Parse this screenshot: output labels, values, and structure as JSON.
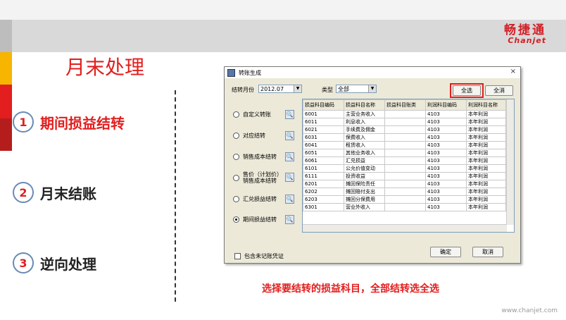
{
  "brand": {
    "name_cn": "畅捷通",
    "name_en": "Chanjet"
  },
  "slide": {
    "title": "月末处理",
    "caption": "选择要结转的损益科目，全部结转选全选",
    "footer": "www.chanjet.com"
  },
  "steps": [
    {
      "num": "1",
      "label": "期间损益结转"
    },
    {
      "num": "2",
      "label": "月末结账"
    },
    {
      "num": "3",
      "label": "逆向处理"
    }
  ],
  "dialog": {
    "title": "转账生成",
    "period_label": "结转月份",
    "period_value": "2012.07",
    "type_label": "类型",
    "type_value": "全部",
    "select_all": "全选",
    "clear_all": "全消",
    "ok": "确定",
    "cancel": "取消",
    "include_unposted": "包含未记账凭证",
    "options": [
      {
        "label": "自定义转账",
        "selected": false
      },
      {
        "label": "对应结转",
        "selected": false
      },
      {
        "label": "销售成本结转",
        "selected": false
      },
      {
        "label": "售价（计划价）销售成本结转",
        "selected": false
      },
      {
        "label": "汇兑损益结转",
        "selected": false
      },
      {
        "label": "期间损益结转",
        "selected": true
      }
    ],
    "columns": [
      "损益科目编码",
      "损益科目名称",
      "损益科目账类",
      "利润科目编码",
      "利润科目名称"
    ],
    "rows": [
      [
        "6001",
        "主营业务收入",
        "",
        "4103",
        "本年利润"
      ],
      [
        "6011",
        "利息收入",
        "",
        "4103",
        "本年利润"
      ],
      [
        "6021",
        "手续费及佣金",
        "",
        "4103",
        "本年利润"
      ],
      [
        "6031",
        "保费收入",
        "",
        "4103",
        "本年利润"
      ],
      [
        "6041",
        "租赁收入",
        "",
        "4103",
        "本年利润"
      ],
      [
        "6051",
        "其他业务收入",
        "",
        "4103",
        "本年利润"
      ],
      [
        "6061",
        "汇兑损益",
        "",
        "4103",
        "本年利润"
      ],
      [
        "6101",
        "公允价值变动",
        "",
        "4103",
        "本年利润"
      ],
      [
        "6111",
        "投资收益",
        "",
        "4103",
        "本年利润"
      ],
      [
        "6201",
        "摊回保险责任",
        "",
        "4103",
        "本年利润"
      ],
      [
        "6202",
        "摊回赔付支出",
        "",
        "4103",
        "本年利润"
      ],
      [
        "6203",
        "摊回分保费用",
        "",
        "4103",
        "本年利润"
      ],
      [
        "6301",
        "营业外收入",
        "",
        "4103",
        "本年利润"
      ]
    ]
  }
}
